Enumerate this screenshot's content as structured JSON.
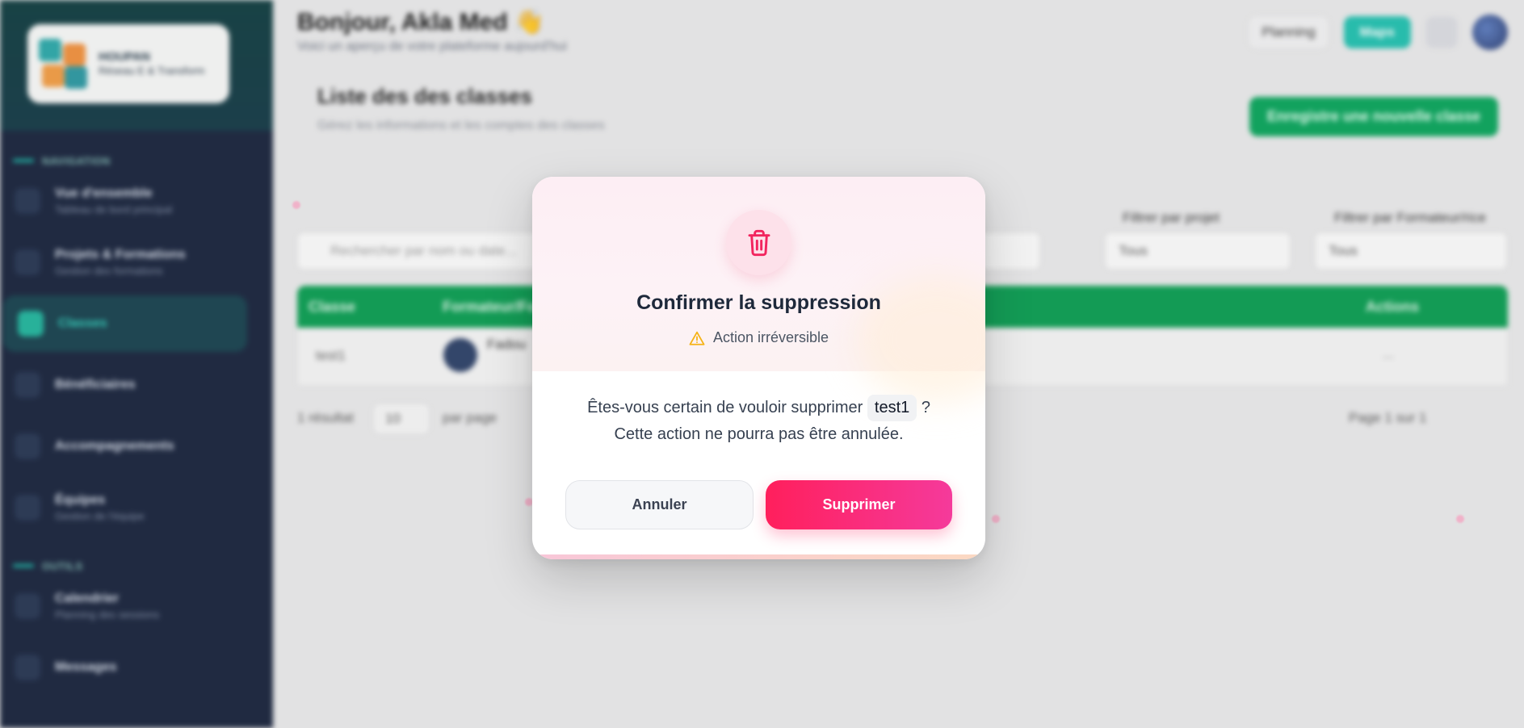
{
  "sidebar": {
    "logo": {
      "title": "HOUPAN",
      "subtitle": "Réseau E & Transform"
    },
    "sections": [
      {
        "label": "NAVIGATION"
      },
      {
        "label": "OUTILS"
      }
    ],
    "items": [
      {
        "label": "Vue d'ensemble",
        "sub": "Tableau de bord principal"
      },
      {
        "label": "Projets & Formations",
        "sub": "Gestion des formations"
      },
      {
        "label": "Classes",
        "sub": ""
      },
      {
        "label": "Bénéficiaires",
        "sub": ""
      },
      {
        "label": "Accompagnements",
        "sub": ""
      },
      {
        "label": "Équipes",
        "sub": "Gestion de l'équipe"
      },
      {
        "label": "Calendrier",
        "sub": "Planning des sessions"
      },
      {
        "label": "Messages",
        "sub": ""
      }
    ]
  },
  "header": {
    "greeting": "Bonjour, Akla Med 👋",
    "subtitle": "Voici un aperçu de votre plateforme aujourd'hui",
    "planning_label": "Planning",
    "maps_label": "Maps"
  },
  "page": {
    "title": "Liste des des classes",
    "subtitle": "Gérez les informations et les comptes des classes",
    "add_label": "Enregistre une nouvelle classe",
    "search_placeholder": "Rechercher par nom ou date...",
    "filter_project_label": "Filtrer par projet",
    "filter_trainer_label": "Filtrer par Formateur/rice",
    "filter_project_value": "Tous",
    "filter_trainer_value": "Tous",
    "table_headers": [
      "Classe",
      "Formateur/Fo",
      "Actions"
    ],
    "row": {
      "classe": "test1",
      "formateur": "Fadou",
      "actions": "..."
    },
    "result_count": "1 résultat",
    "per_page_value": "10",
    "per_page_label": "par page",
    "page_label": "Page 1 sur 1"
  },
  "modal": {
    "title": "Confirmer la suppression",
    "warning": "Action irréversible",
    "question_before": "Êtes-vous certain de vouloir supprimer",
    "item_name": "test1",
    "question_after": "?",
    "note": "Cette action ne pourra pas être annulée.",
    "cancel_label": "Annuler",
    "delete_label": "Supprimer"
  },
  "colors": {
    "accent_pink": "#ff1f5c",
    "accent_magenta": "#f53a9b",
    "warning_yellow": "#f5b316",
    "sidebar_bg": "#16213a",
    "brand_green": "#07a35a",
    "brand_teal": "#1fbfae"
  },
  "icons": {
    "modal_icon": "trash-icon",
    "warning_icon": "warning-triangle-icon"
  }
}
